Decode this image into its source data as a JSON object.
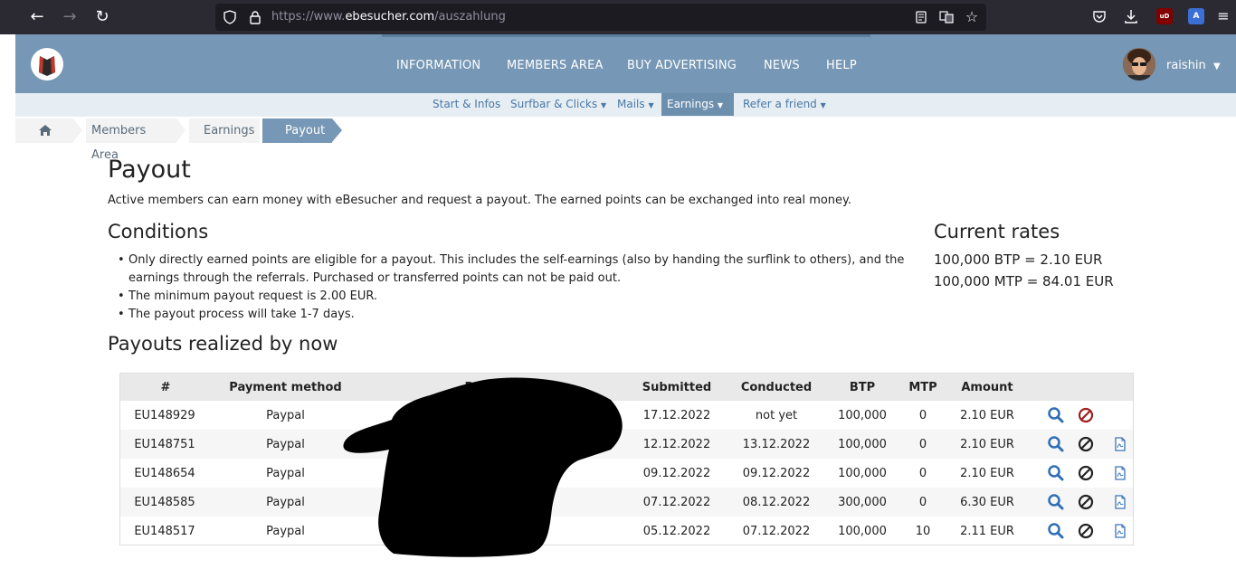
{
  "browser": {
    "url_scheme": "https://www.",
    "url_host": "ebesucher.com",
    "url_path": "/auszahlung"
  },
  "header": {
    "nav": [
      "INFORMATION",
      "MEMBERS AREA",
      "BUY ADVERTISING",
      "NEWS",
      "HELP"
    ],
    "username": "raishin"
  },
  "subnav": [
    "Start & Infos",
    "Surfbar & Clicks",
    "Mails",
    "Earnings",
    "Refer a friend"
  ],
  "breadcrumb": [
    "Members Area",
    "Earnings",
    "Payout"
  ],
  "page": {
    "title": "Payout",
    "intro": "Active members can earn money with eBesucher and request a payout. The earned points can be exchanged into real money.",
    "conditions_title": "Conditions",
    "conditions": [
      "Only directly earned points are eligible for a payout. This includes the self-earnings (also by handing the surflink to others), and the earnings through the referrals. Purchased or transferred points can not be paid out.",
      "The minimum payout request is 2.00 EUR.",
      "The payout process will take 1-7 days."
    ],
    "rates_title": "Current rates",
    "rates": [
      "100,000 BTP = 2.10 EUR",
      "100,000 MTP = 84.01 EUR"
    ],
    "payouts_title": "Payouts realized by now"
  },
  "table": {
    "headers": [
      "#",
      "Payment method",
      "Recipient",
      "Submitted",
      "Conducted",
      "BTP",
      "MTP",
      "Amount"
    ],
    "rows": [
      {
        "id": "EU148929",
        "method": "Paypal",
        "submitted": "17.12.2022",
        "conducted": "not yet",
        "btp": "100,000",
        "mtp": "0",
        "amount": "2.10 EUR",
        "pending": true
      },
      {
        "id": "EU148751",
        "method": "Paypal",
        "submitted": "12.12.2022",
        "conducted": "13.12.2022",
        "btp": "100,000",
        "mtp": "0",
        "amount": "2.10 EUR",
        "pending": false
      },
      {
        "id": "EU148654",
        "method": "Paypal",
        "submitted": "09.12.2022",
        "conducted": "09.12.2022",
        "btp": "100,000",
        "mtp": "0",
        "amount": "2.10 EUR",
        "pending": false
      },
      {
        "id": "EU148585",
        "method": "Paypal",
        "submitted": "07.12.2022",
        "conducted": "08.12.2022",
        "btp": "300,000",
        "mtp": "0",
        "amount": "6.30 EUR",
        "pending": false
      },
      {
        "id": "EU148517",
        "method": "Paypal",
        "submitted": "05.12.2022",
        "conducted": "07.12.2022",
        "btp": "100,000",
        "mtp": "10",
        "amount": "2.11 EUR",
        "pending": false
      }
    ]
  },
  "colors": {
    "header_bg": "#7697b5",
    "subnav_bg": "#e6eef4",
    "link": "#4a78a5",
    "search_icon": "#2f6eb5",
    "cancel_active": "#a02020",
    "cancel_inactive": "#222222",
    "pdf_icon": "#3a74b8"
  }
}
